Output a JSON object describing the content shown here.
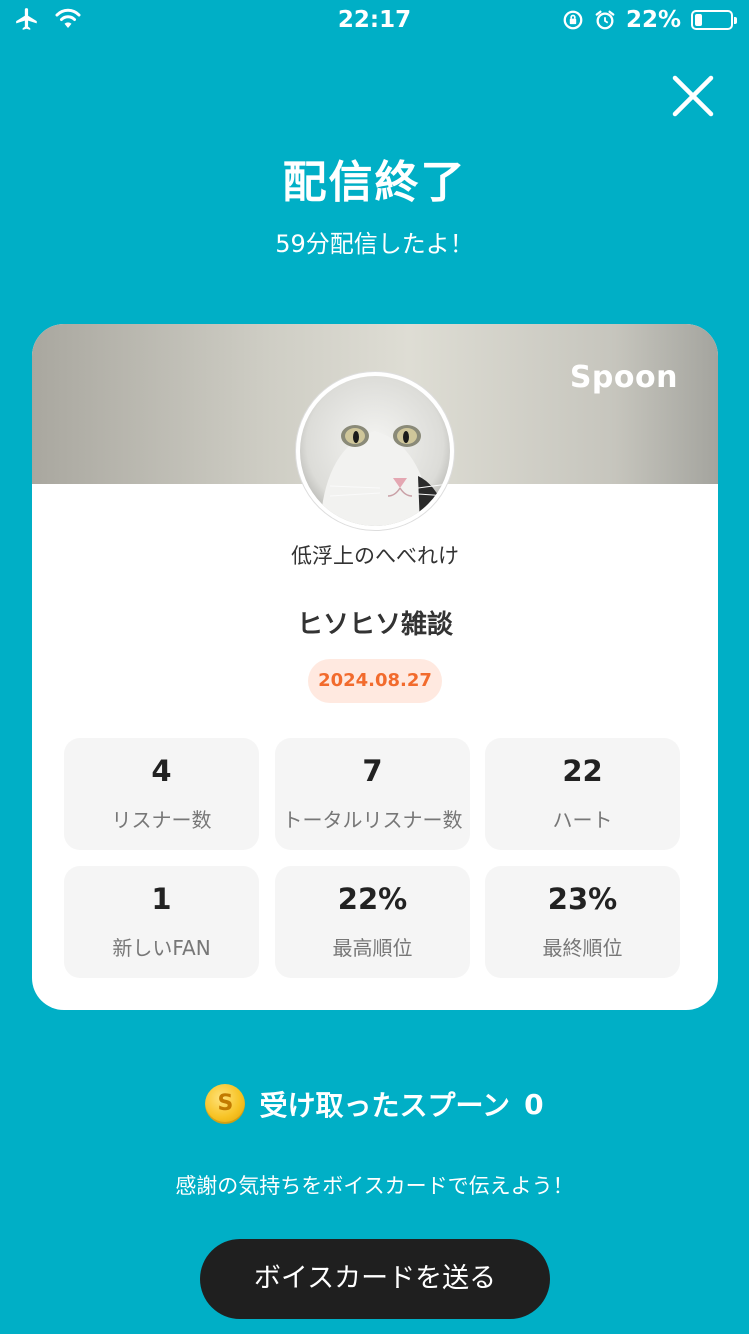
{
  "status": {
    "time": "22:17",
    "battery": "22%",
    "battery_level": 0.22
  },
  "header": {
    "title": "配信終了",
    "subtitle": "59分配信したよ！"
  },
  "card": {
    "brand": "Spoon",
    "username": "低浮上のへべれけ",
    "show_title": "ヒソヒソ雑談",
    "date": "2024.08.27",
    "stats": [
      {
        "value": "4",
        "label": "リスナー数"
      },
      {
        "value": "7",
        "label": "トータルリスナー数"
      },
      {
        "value": "22",
        "label": "ハート"
      },
      {
        "value": "1",
        "label": "新しいFAN"
      },
      {
        "value": "22%",
        "label": "最高順位"
      },
      {
        "value": "23%",
        "label": "最終順位"
      }
    ]
  },
  "spoons": {
    "label": "受け取ったスプーン",
    "count": "0",
    "coin_symbol": "S"
  },
  "thanks_text": "感謝の気持ちをボイスカードで伝えよう！",
  "send_button_label": "ボイスカードを送る",
  "colors": {
    "background": "#00AFC6",
    "date_badge_bg": "#FFE9E0",
    "date_badge_text": "#F26B2D",
    "button_bg": "#1f1f1f"
  }
}
